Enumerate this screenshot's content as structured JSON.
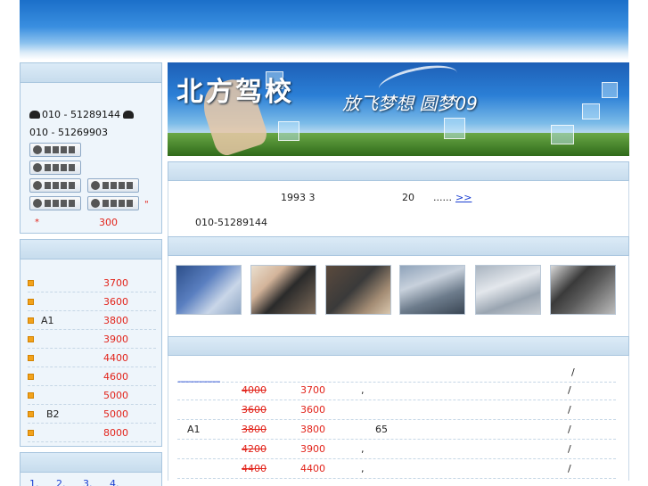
{
  "contact": {
    "phone1": "010 - 51289144",
    "phone2": "010 - 51269903",
    "qq_label": "留言咨询",
    "mark1": "\"",
    "mark2": "*",
    "amount": "300"
  },
  "hero": {
    "title": "北方驾校",
    "slogan": "放飞梦想 圆梦09"
  },
  "intro": {
    "year": "1993 3",
    "years_count": "20",
    "ellipsis": "......",
    "more_link": ">>",
    "tel": "010-51289144"
  },
  "price_list": [
    {
      "name": "",
      "price": "3700"
    },
    {
      "name": "",
      "price": "3600"
    },
    {
      "name": "A1",
      "price": "3800"
    },
    {
      "name": "",
      "price": "3900"
    },
    {
      "name": "",
      "price": "4400"
    },
    {
      "name": "",
      "price": "4600"
    },
    {
      "name": "",
      "price": "5000"
    },
    {
      "name": "B2",
      "price": "5000"
    },
    {
      "name": "",
      "price": "8000"
    }
  ],
  "pager": [
    "1.",
    "2.",
    "3.",
    "4."
  ],
  "fee_table": {
    "header_link": "----------------",
    "header_slash": "/",
    "rows": [
      {
        "cls": "",
        "old": "4000",
        "now": "3700",
        "note": ",",
        "age": "",
        "sl": "/"
      },
      {
        "cls": "",
        "old": "3600",
        "now": "3600",
        "note": "",
        "age": "",
        "sl": "/"
      },
      {
        "cls": "A1",
        "old": "3800",
        "now": "3800",
        "note": "",
        "age": "65",
        "sl": "/"
      },
      {
        "cls": "",
        "old": "4200",
        "now": "3900",
        "note": ",",
        "age": "",
        "sl": "/"
      },
      {
        "cls": "",
        "old": "4400",
        "now": "4400",
        "note": ",",
        "age": "",
        "sl": "/"
      }
    ]
  },
  "colors": {
    "accent_red": "#e2231a",
    "link_blue": "#1a3fd1",
    "panel_border": "#a9c6df"
  },
  "icons": {
    "phone": "phone-icon",
    "qq": "qq-penguin-icon",
    "bullet": "bullet-icon"
  }
}
